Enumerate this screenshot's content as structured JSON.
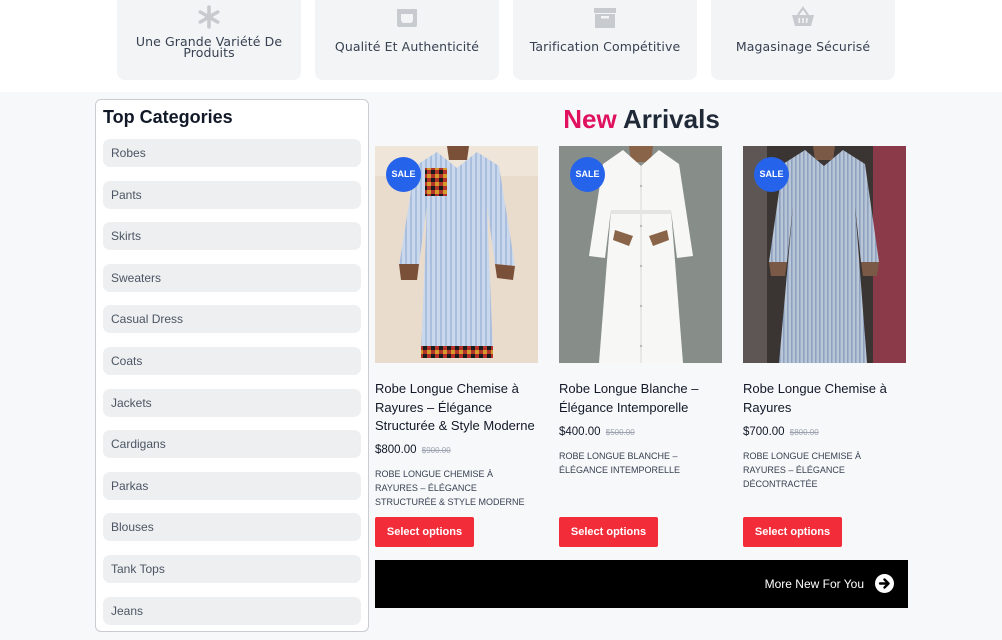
{
  "features": [
    {
      "icon": "asterisk-icon",
      "line1": "Une Grande Variété De",
      "line2": "Produits"
    },
    {
      "icon": "cup-icon",
      "line1": "Qualité Et Authenticité",
      "line2": ""
    },
    {
      "icon": "archive-box-icon",
      "line1": "Tarification Compétitive",
      "line2": ""
    },
    {
      "icon": "shopping-basket-icon",
      "line1": "Magasinage Sécurisé",
      "line2": ""
    }
  ],
  "sidebar": {
    "title": "Top Categories",
    "items": [
      "Robes",
      "Pants",
      "Skirts",
      "Sweaters",
      "Casual Dress",
      "Coats",
      "Jackets",
      "Cardigans",
      "Parkas",
      "Blouses",
      "Tank Tops",
      "Jeans"
    ]
  },
  "heading": {
    "accent": "New",
    "rest": "Arrivals"
  },
  "products": [
    {
      "badge": "SALE",
      "title": "Robe Longue Chemise à Rayures – Élégance Structurée & Style Moderne",
      "price": "$800.00",
      "old_price": "$900.00",
      "description": "Robe Longue Chemise à Rayures – Élégance Structurée & Style Moderne",
      "button": "Select options"
    },
    {
      "badge": "SALE",
      "title": "Robe Longue Blanche – Élégance Intemporelle",
      "price": "$400.00",
      "old_price": "$500.00",
      "description": "Robe Longue Blanche – Élégance Intemporelle",
      "button": "Select options"
    },
    {
      "badge": "SALE",
      "title": "Robe Longue Chemise à Rayures",
      "price": "$700.00",
      "old_price": "$800.00",
      "description": "Robe Longue Chemise à Rayures – Élégance Décontractée",
      "button": "Select options"
    }
  ],
  "more_button": {
    "label": "More New For You",
    "icon": "arrow-right-circle-icon"
  },
  "colors": {
    "accent": "#e0115f",
    "sale_badge": "#2563eb",
    "button": "#f32c3a",
    "more_bar": "#000000"
  }
}
